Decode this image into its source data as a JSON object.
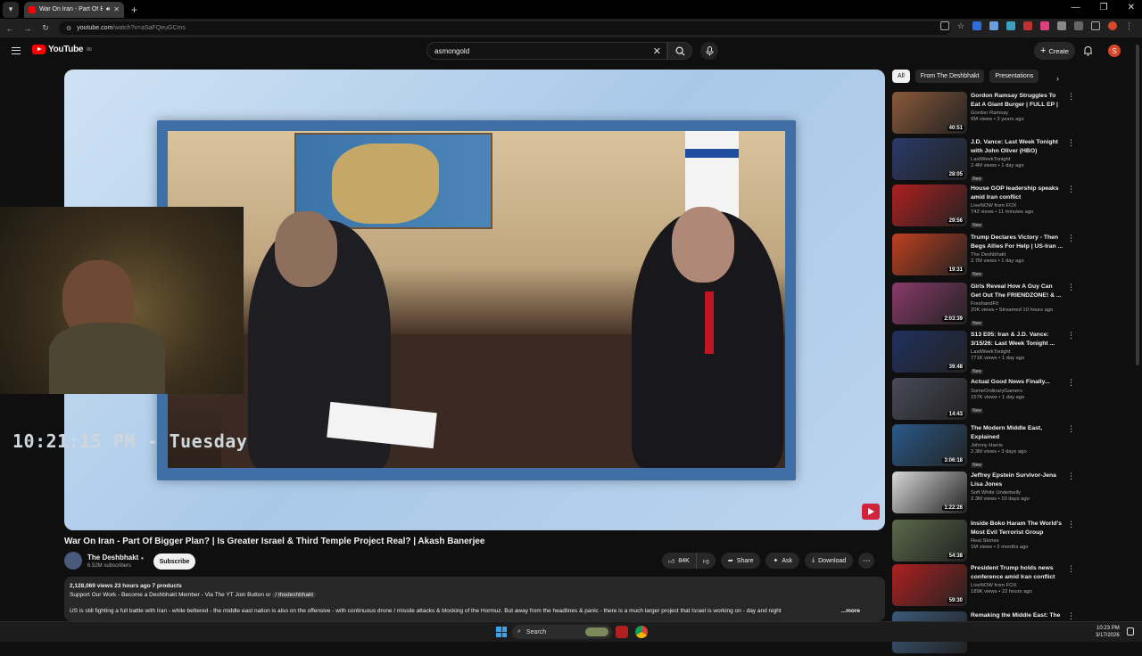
{
  "browser": {
    "tab_title": "War On Iran - Part Of Bigger",
    "url_host": "youtube.com",
    "url_path": "/watch?v=aSaFQeuGCms"
  },
  "header": {
    "logo_text": "YouTube",
    "logo_sup": "80",
    "search_value": "asmongold",
    "create_label": "Create",
    "avatar_letter": "S"
  },
  "overlay": {
    "clock_text": "10:21:15 PM - Tuesday"
  },
  "video": {
    "title": "War On Iran - Part Of Bigger Plan? | Is Greater Israel & Third Temple Project Real? | Akash Banerjee",
    "channel": "The Deshbhakt",
    "subscribers": "6.52M subscribers",
    "subscribe_label": "Subscribe",
    "likes": "84K",
    "share_label": "Share",
    "ask_label": "Ask",
    "download_label": "Download",
    "stats": "2,128,069 views  23 hours ago  7 products",
    "desc_line2_text": "Support Our Work - Become a Deshbhakt Member - Via The YT Join Button or",
    "desc_tag": "/ thedeshbhakt",
    "desc_line3": "US is still fighting a full battle with Iran - while bettered - the middle east nation is also on the offensive - with continuous drone / missile attacks & blocking of the Hormuz. But away from the headlines & panic - there is a much larger project that Israel is working on - day and night",
    "more_label": "...more"
  },
  "chips": [
    "All",
    "From The Deshbhakt",
    "Presentations"
  ],
  "sidebar": {
    "items": [
      {
        "title": "Gordon Ramsay Struggles To Eat A Giant Burger | FULL EP | ...",
        "channel": "Gordon Ramsay",
        "meta": "6M views • 3 years ago",
        "duration": "40:51",
        "new": "",
        "color": "#8a5a3a"
      },
      {
        "title": "J.D. Vance: Last Week Tonight with John Oliver (HBO)",
        "channel": "LastWeekTonight",
        "meta": "2.4M views • 1 day ago",
        "duration": "28:05",
        "new": "New",
        "color": "#2a3a6a"
      },
      {
        "title": "House GOP leadership speaks amid Iran conflict",
        "channel": "LiveNOW from FOX",
        "meta": "742 views • 11 minutes ago",
        "duration": "29:56",
        "new": "New",
        "color": "#b02020"
      },
      {
        "title": "Trump Declares Victory - Then Begs Allies For Help | US-Iran ...",
        "channel": "The Deshbhakt",
        "meta": "2.7M views • 1 day ago",
        "duration": "19:31",
        "new": "New",
        "color": "#c04020"
      },
      {
        "title": "Girls Reveal How A Guy Can Get Out The FRIENDZONE! & ...",
        "channel": "FreshandFit",
        "meta": "20K views • Streamed 10 hours ago",
        "duration": "2:03:39",
        "new": "New",
        "color": "#8a3a6a"
      },
      {
        "title": "S13 E05: Iran & J.D. Vance: 3/15/26: Last Week Tonight ...",
        "channel": "LastWeekTonight",
        "meta": "771K views • 1 day ago",
        "duration": "39:48",
        "new": "New",
        "color": "#203060"
      },
      {
        "title": "Actual Good News Finally...",
        "channel": "SomeOrdinaryGamers",
        "meta": "157K views • 1 day ago",
        "duration": "14:43",
        "new": "New",
        "color": "#4a4a5a"
      },
      {
        "title": "The Modern Middle East, Explained",
        "channel": "Johnny Harris",
        "meta": "2.3M views • 3 days ago",
        "duration": "3:06:18",
        "new": "New",
        "color": "#2a5a8a"
      },
      {
        "title": "Jeffrey Epstein Survivor-Jena Lisa Jones",
        "channel": "Soft White Underbelly",
        "meta": "2.3M views • 10 days ago",
        "duration": "1:22:26",
        "new": "",
        "color": "#d8d8d8"
      },
      {
        "title": "Inside Boko Haram The World's Most Evil Terrorist Group",
        "channel": "Real Stories",
        "meta": "1M views • 2 months ago",
        "duration": "54:38",
        "new": "",
        "color": "#5a6a4a"
      },
      {
        "title": "President Trump holds news conference amid Iran conflict",
        "channel": "LiveNOW from FOX",
        "meta": "189K views • 22 hours ago",
        "duration": "59:30",
        "new": "",
        "color": "#b02020"
      },
      {
        "title": "Remaking the Middle East: The",
        "channel": "",
        "meta": "",
        "duration": "",
        "new": "",
        "color": "#3a5a7a"
      }
    ]
  },
  "taskbar": {
    "search_label": "Search",
    "time": "10:23 PM",
    "date": "3/17/2026"
  }
}
